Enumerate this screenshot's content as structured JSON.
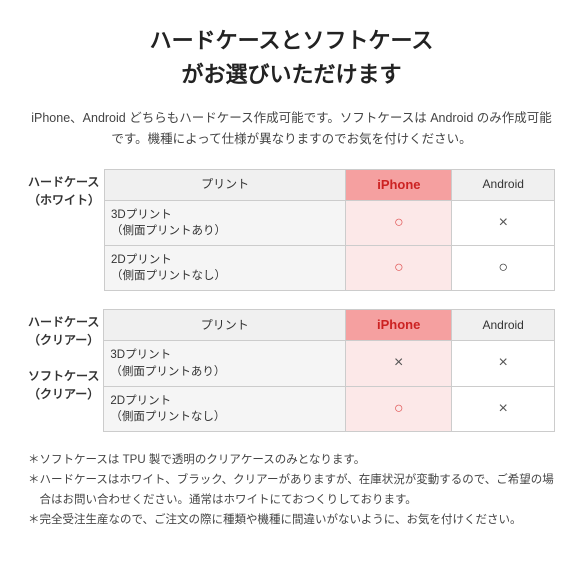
{
  "title": {
    "line1": "ハードケースとソフトケース",
    "line2": "がお選びいただけます"
  },
  "description": "iPhone、Android どちらもハードケース作成可能です。ソフトケースは\nAndroid のみ作成可能です。機種によって仕様が異なりますのでお気を付けください。",
  "table1": {
    "row_label_line1": "ハードケース",
    "row_label_line2": "（ホワイト）",
    "header": [
      "プリント",
      "iPhone",
      "Android"
    ],
    "rows": [
      {
        "print": "3Dプリント\n（側面プリントあり）",
        "iphone": "○",
        "android": "×"
      },
      {
        "print": "2Dプリント\n（側面プリントなし）",
        "iphone": "○",
        "android": "○"
      }
    ]
  },
  "table2": {
    "row_label_line1": "ハードケース",
    "row_label_line2": "（クリアー）",
    "row_label2_line1": "ソフトケース",
    "row_label2_line2": "（クリアー）",
    "header": [
      "プリント",
      "iPhone",
      "Android"
    ],
    "rows": [
      {
        "print": "3Dプリント\n（側面プリントあり）",
        "iphone": "×",
        "android": "×"
      },
      {
        "print": "2Dプリント\n（側面プリントなし）",
        "iphone": "○",
        "android": "×"
      }
    ]
  },
  "notes": [
    "ソフトケースは TPU 製で透明のクリアケースのみとなります。",
    "ハードケースはホワイト、ブラック、クリアーがありますが、在庫状況が変動するので、ご希望の場合はお問い合わせください。通常はホワイトにておつくりしております。",
    "完全受注生産なので、ご注文の際に種類や機種に間違いがないように、お気を付けください。"
  ],
  "icons": {
    "circle": "○",
    "cross": "×"
  }
}
